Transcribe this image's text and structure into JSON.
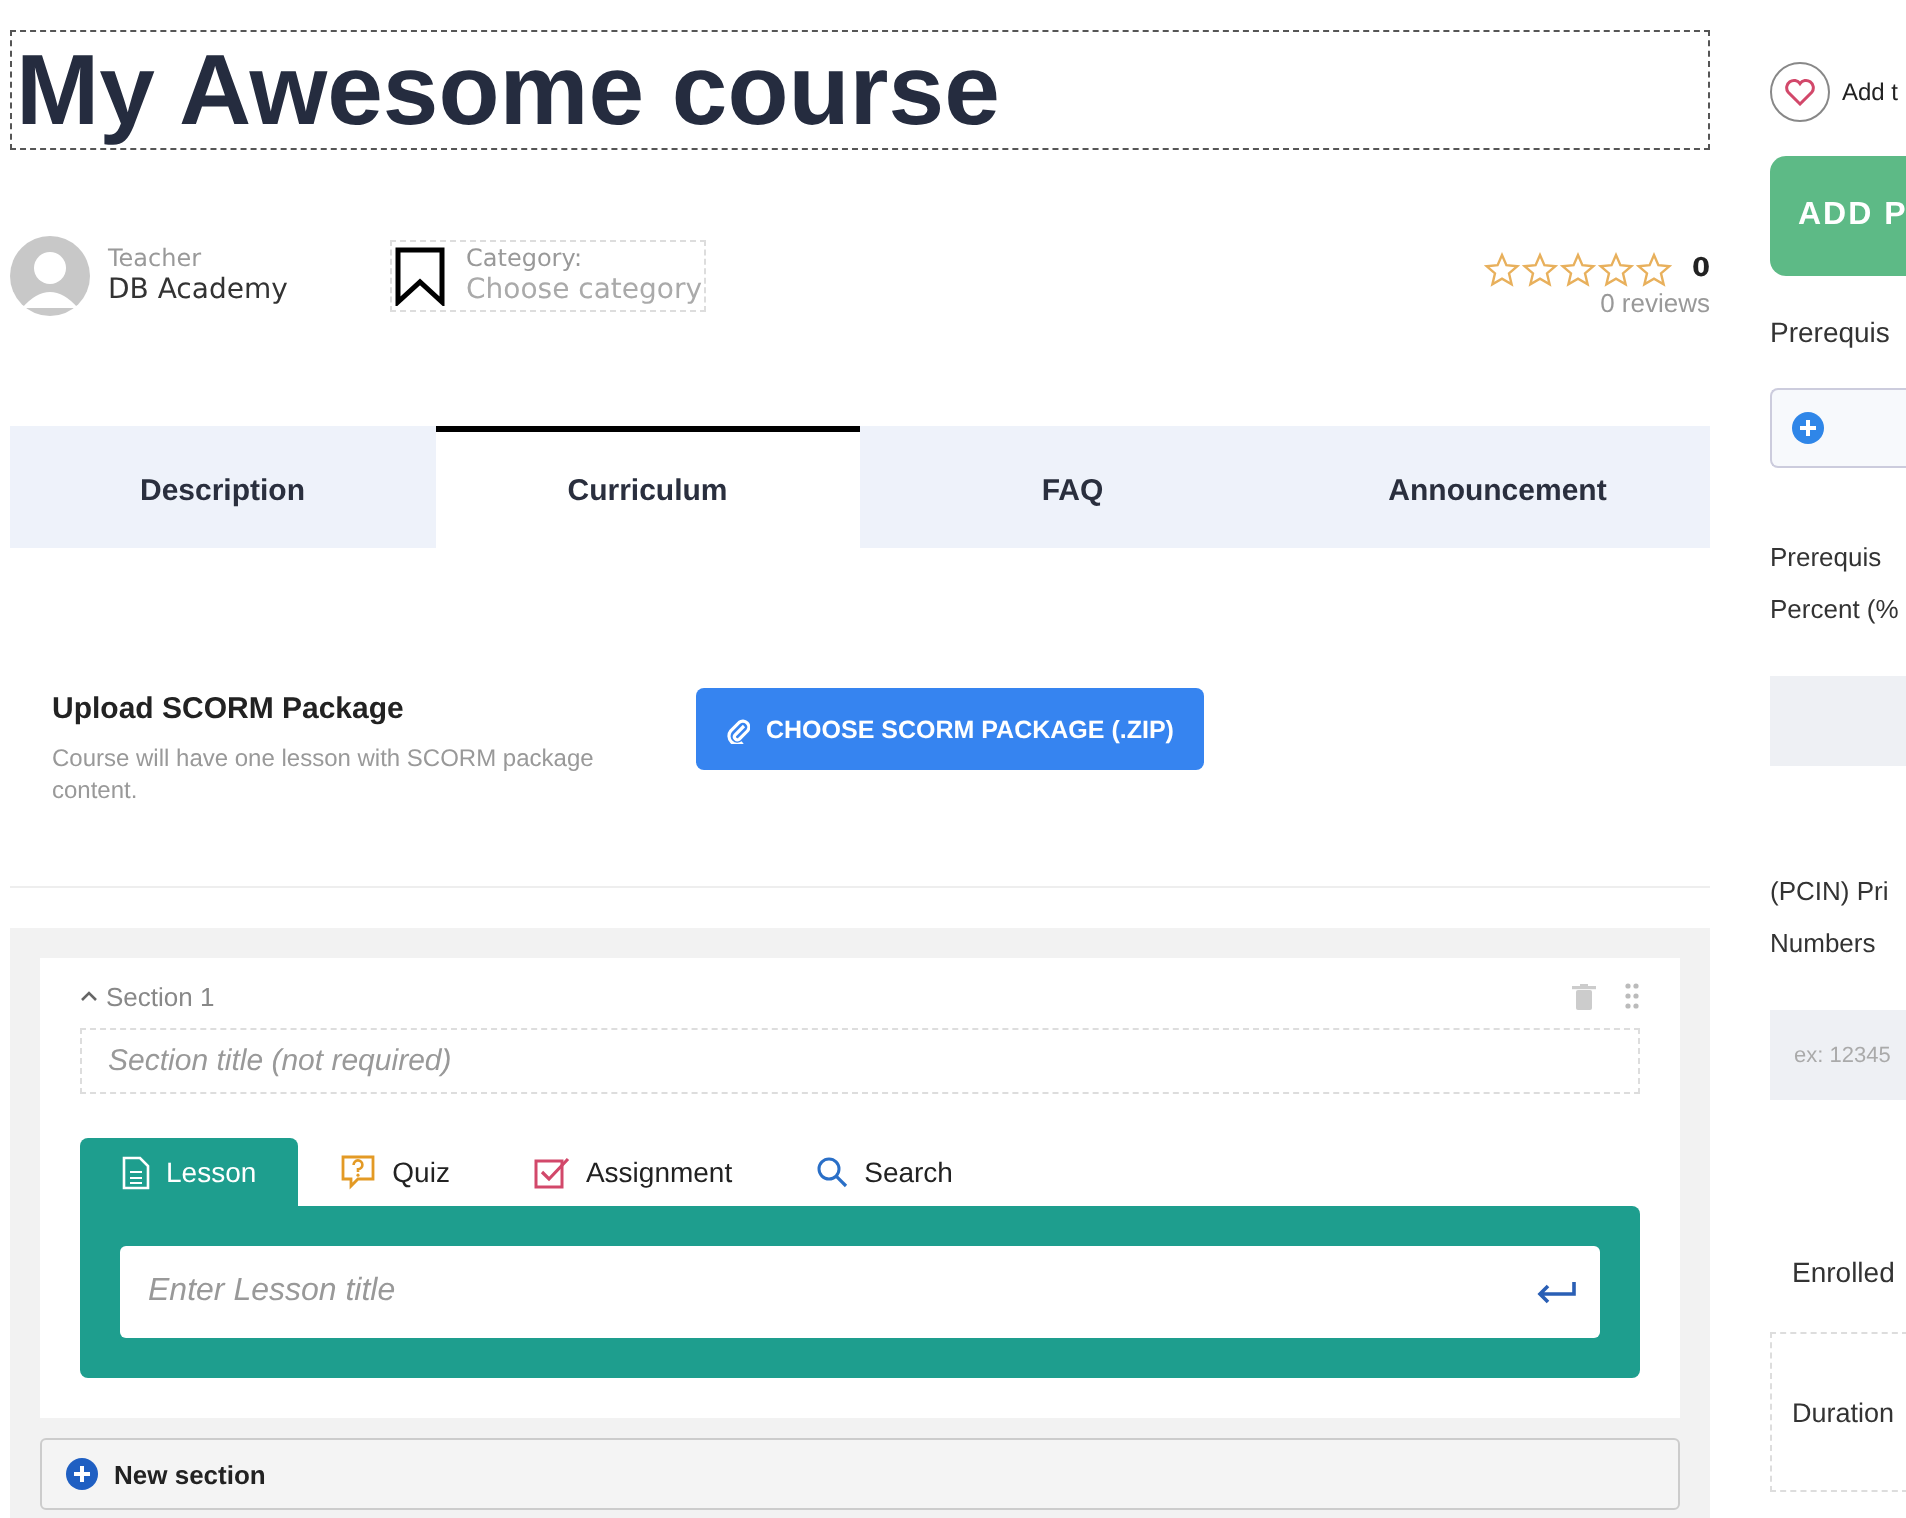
{
  "course": {
    "title": "My Awesome course",
    "teacher_label": "Teacher",
    "teacher_name": "DB Academy",
    "category_label": "Category:",
    "category_placeholder": "Choose category",
    "stars": 0,
    "rating": "0",
    "reviews": "0 reviews"
  },
  "tabs": [
    {
      "label": "Description",
      "selected": false
    },
    {
      "label": "Curriculum",
      "selected": true
    },
    {
      "label": "FAQ",
      "selected": false
    },
    {
      "label": "Announcement",
      "selected": false
    }
  ],
  "scorm": {
    "title": "Upload SCORM Package",
    "description": "Course will have one lesson with SCORM package content.",
    "button": "CHOOSE SCORM PACKAGE (.ZIP)"
  },
  "section": {
    "label": "Section 1",
    "expanded": true,
    "title_placeholder": "Section title (not required)",
    "item_tabs": [
      {
        "kind": "lesson",
        "label": "Lesson",
        "selected": true
      },
      {
        "kind": "quiz",
        "label": "Quiz",
        "selected": false
      },
      {
        "kind": "assignment",
        "label": "Assignment",
        "selected": false
      },
      {
        "kind": "search",
        "label": "Search",
        "selected": false
      }
    ],
    "input_placeholder": "Enter Lesson title"
  },
  "new_section": "New section",
  "sidebar": {
    "wishlist": "Add t",
    "add_button": "ADD P",
    "prereq_label": "Prerequis",
    "prereq_percent_label": [
      "Prerequis",
      "Percent (%"
    ],
    "pcin_label": [
      "(PCIN) Pri",
      "Numbers"
    ],
    "pcin_placeholder": "ex: 12345",
    "enrolled": "Enrolled",
    "duration": "Duration"
  }
}
